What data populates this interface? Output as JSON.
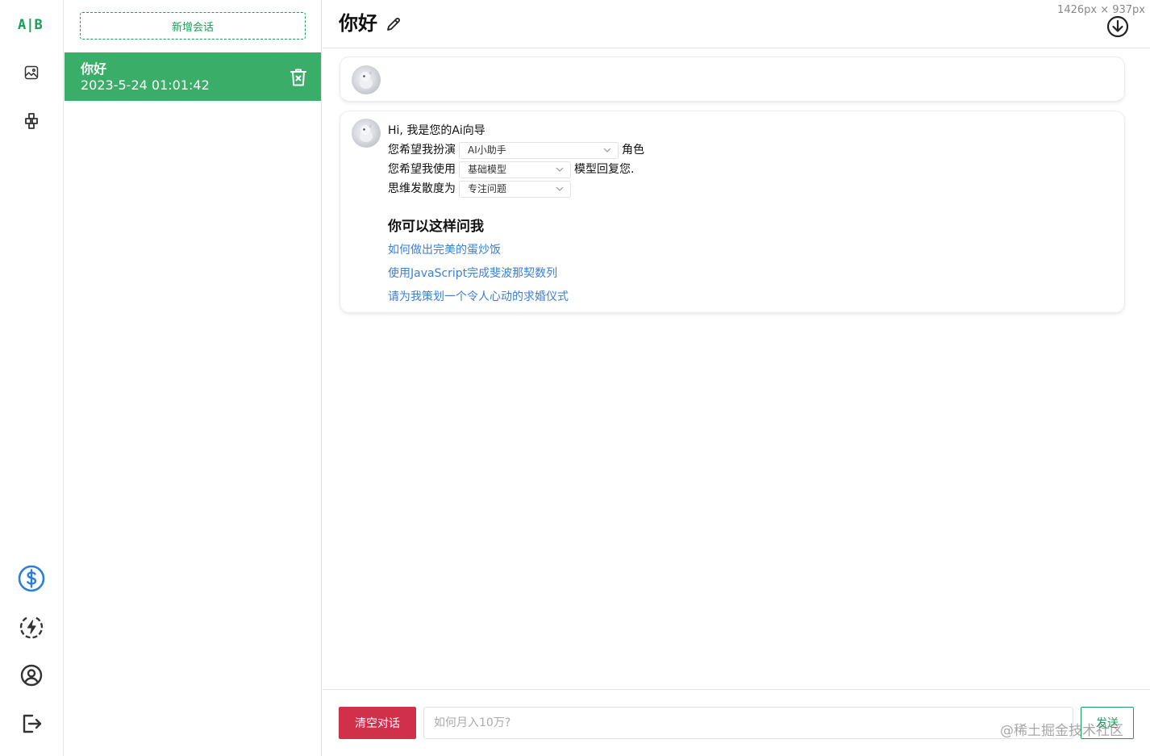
{
  "rail": {
    "logo": "A|B",
    "icons": [
      "image-icon",
      "plugin-icon",
      "dollar-icon",
      "lightning-icon",
      "user-icon",
      "logout-icon"
    ],
    "accent": "#18a058",
    "dollar_color": "#2a7fd9"
  },
  "sessions": {
    "new_label": "新增会话",
    "items": [
      {
        "title": "你好",
        "time": "2023-5-24 01:01:42"
      }
    ],
    "active_bg": "#3aae68"
  },
  "header": {
    "title": "你好",
    "dimension_label": "1426px × 937px"
  },
  "greeting": {
    "intro": "Hi, 我是您的Ai向导",
    "role_prefix": "您希望我扮演",
    "role_value": "AI小助手",
    "role_suffix": "角色",
    "model_prefix": "您希望我使用",
    "model_value": "基础模型",
    "model_suffix": "模型回复您.",
    "divergence_prefix": "思维发散度为",
    "divergence_value": "专注问题",
    "suggest_title": "你可以这样问我",
    "suggestions": [
      "如何做出完美的蛋炒饭",
      "使用JavaScript完成斐波那契数列",
      "请为我策划一个令人心动的求婚仪式"
    ],
    "link_color": "#3b7fd6"
  },
  "footer": {
    "clear_label": "清空对话",
    "input_placeholder": "如何月入10万?",
    "input_value": "",
    "send_label": "发送",
    "watermark": "@稀土掘金技术社区",
    "clear_color": "#d0304a"
  }
}
